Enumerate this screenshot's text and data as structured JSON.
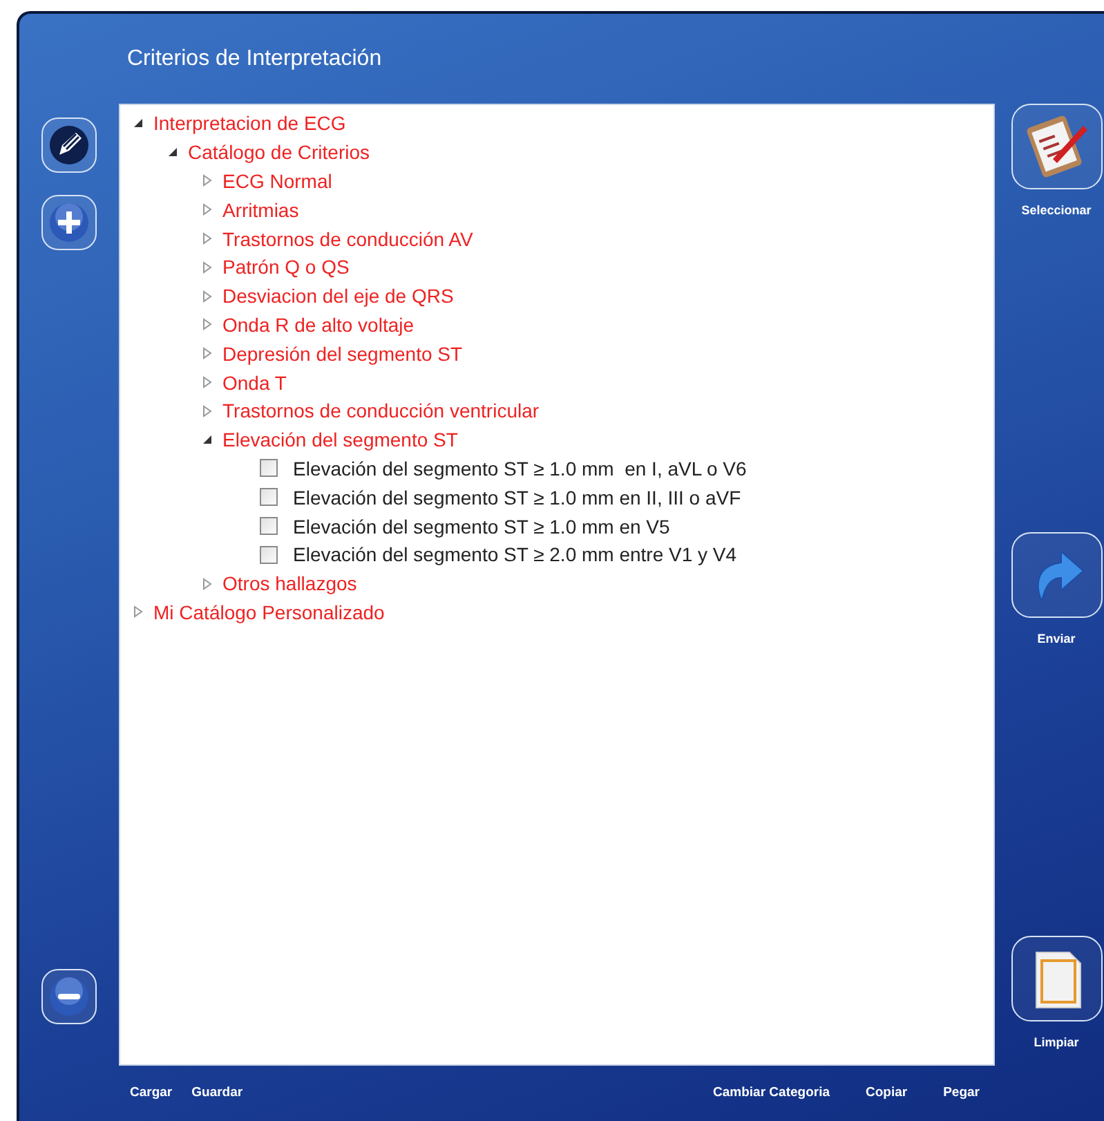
{
  "window": {
    "title": "Criterios de Interpretación"
  },
  "left_buttons": [
    {
      "kind": "edit"
    },
    {
      "kind": "add"
    },
    {
      "kind": "remove"
    }
  ],
  "tree": [
    {
      "kind": "folder",
      "label": "Interpretacion de ECG",
      "expanded": true,
      "children": [
        {
          "kind": "folder",
          "label": "Catálogo de Criterios",
          "expanded": true,
          "children": [
            {
              "kind": "folder",
              "label": "ECG Normal",
              "expanded": false
            },
            {
              "kind": "folder",
              "label": "Arritmias",
              "expanded": false
            },
            {
              "kind": "folder",
              "label": "Trastornos de conducción AV",
              "expanded": false
            },
            {
              "kind": "folder",
              "label": "Patrón Q o QS",
              "expanded": false
            },
            {
              "kind": "folder",
              "label": "Desviacion del eje de QRS",
              "expanded": false
            },
            {
              "kind": "folder",
              "label": "Onda R de alto voltaje",
              "expanded": false
            },
            {
              "kind": "folder",
              "label": "Depresión del segmento ST",
              "expanded": false
            },
            {
              "kind": "folder",
              "label": "Onda T",
              "expanded": false
            },
            {
              "kind": "folder",
              "label": "Trastornos de conducción ventricular",
              "expanded": false
            },
            {
              "kind": "folder",
              "label": "Elevación del segmento ST",
              "expanded": true,
              "children": [
                {
                  "kind": "check",
                  "label": "Elevación del segmento ST ≥ 1.0 mm  en I, aVL o V6",
                  "checked": false
                },
                {
                  "kind": "check",
                  "label": "Elevación del segmento ST ≥ 1.0 mm en II, III o aVF",
                  "checked": false
                },
                {
                  "kind": "check",
                  "label": "Elevación del segmento ST ≥ 1.0 mm en V5",
                  "checked": false
                },
                {
                  "kind": "check",
                  "label": "Elevación del segmento ST ≥ 2.0 mm entre V1 y V4",
                  "checked": false
                }
              ]
            },
            {
              "kind": "folder",
              "label": "Otros hallazgos",
              "expanded": false
            }
          ]
        }
      ]
    },
    {
      "kind": "folder",
      "label": "Mi Catálogo Personalizado",
      "expanded": false
    }
  ],
  "right_buttons": [
    {
      "kind": "select",
      "label": "Seleccionar"
    },
    {
      "kind": "send",
      "label": "Enviar"
    },
    {
      "kind": "clear",
      "label": "Limpiar"
    }
  ],
  "bottom_left": [
    "Cargar",
    "Guardar"
  ],
  "bottom_right": [
    "Cambiar Categoria",
    "Copiar",
    "Pegar"
  ]
}
